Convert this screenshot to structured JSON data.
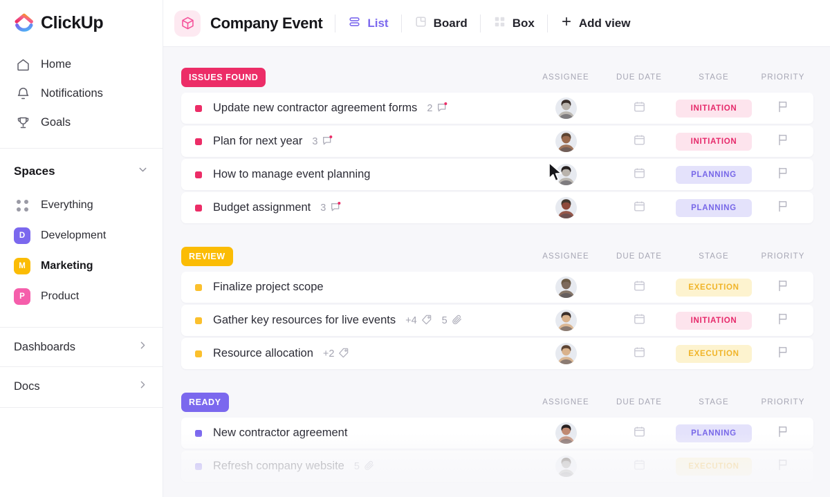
{
  "brand": {
    "name": "ClickUp"
  },
  "sidebar": {
    "nav": [
      {
        "label": "Home",
        "icon": "home-icon"
      },
      {
        "label": "Notifications",
        "icon": "bell-icon"
      },
      {
        "label": "Goals",
        "icon": "trophy-icon"
      }
    ],
    "spaces": {
      "title": "Spaces",
      "collapse_icon": "chevron-down-icon",
      "items": [
        {
          "label": "Everything",
          "icon": "grid-dots-icon",
          "initial": "",
          "color": "",
          "active": false
        },
        {
          "label": "Development",
          "icon": "space-badge",
          "initial": "D",
          "color": "#7b68ee",
          "active": false
        },
        {
          "label": "Marketing",
          "icon": "space-badge",
          "initial": "M",
          "color": "#fbbc05",
          "active": true
        },
        {
          "label": "Product",
          "icon": "space-badge",
          "initial": "P",
          "color": "#f55eab",
          "active": false
        }
      ]
    },
    "sections": [
      {
        "label": "Dashboards",
        "icon": "chevron-right-icon"
      },
      {
        "label": "Docs",
        "icon": "chevron-right-icon"
      }
    ]
  },
  "header": {
    "list_icon": "cube-icon",
    "title": "Company Event",
    "views": [
      {
        "label": "List",
        "icon": "list-icon",
        "active": true
      },
      {
        "label": "Board",
        "icon": "board-icon",
        "active": false
      },
      {
        "label": "Box",
        "icon": "box-icon",
        "active": false
      }
    ],
    "add_view": {
      "label": "Add view",
      "icon": "plus-icon"
    }
  },
  "columns": {
    "assignee": "ASSIGNEE",
    "due_date": "DUE DATE",
    "stage": "STAGE",
    "priority": "PRIORITY"
  },
  "icons": {
    "due_date": "calendar-icon",
    "priority": "flag-icon",
    "comment": "comment-icon",
    "tag": "tag-icon",
    "attachment": "paperclip-icon"
  },
  "colors": {
    "accent_purple": "#7b68ee",
    "issues_found": "#ec2d67",
    "review": "#fbbc05",
    "ready": "#7b68ee",
    "stage_initiation_bg": "#fde4ed",
    "stage_initiation_fg": "#e6296a",
    "stage_planning_bg": "#e4e2fb",
    "stage_planning_fg": "#7767e8",
    "stage_execution_bg": "#fdf3cf",
    "stage_execution_fg": "#f0b429"
  },
  "groups": [
    {
      "name": "ISSUES FOUND",
      "badge_color": "#ec2d67",
      "dot_color": "#ec2d67",
      "tasks": [
        {
          "title": "Update new contractor agreement forms",
          "comments": "2",
          "tags": "",
          "attachments": "",
          "stage": "INITIATION",
          "stage_bg": "#fde4ed",
          "stage_fg": "#e6296a",
          "avatar": "#b9b3ac"
        },
        {
          "title": "Plan for next year",
          "comments": "3",
          "tags": "",
          "attachments": "",
          "stage": "INITIATION",
          "stage_bg": "#fde4ed",
          "stage_fg": "#e6296a",
          "avatar": "#9a6a4e"
        },
        {
          "title": "How to manage event planning",
          "comments": "",
          "tags": "",
          "attachments": "",
          "stage": "PLANNING",
          "stage_bg": "#e4e2fb",
          "stage_fg": "#7767e8",
          "avatar": "#b9b3ac"
        },
        {
          "title": "Budget assignment",
          "comments": "3",
          "tags": "",
          "attachments": "",
          "stage": "PLANNING",
          "stage_bg": "#e4e2fb",
          "stage_fg": "#7767e8",
          "avatar": "#8e4a3c"
        }
      ]
    },
    {
      "name": "REVIEW",
      "badge_color": "#fbbc05",
      "dot_color": "#fbc02d",
      "tasks": [
        {
          "title": "Finalize project scope",
          "comments": "",
          "tags": "",
          "attachments": "",
          "stage": "EXECUTION",
          "stage_bg": "#fdf3cf",
          "stage_fg": "#f0b429",
          "avatar": "#7d6a5c"
        },
        {
          "title": "Gather key resources for live events",
          "comments": "",
          "tags": "+4",
          "attachments": "5",
          "stage": "INITIATION",
          "stage_bg": "#fde4ed",
          "stage_fg": "#e6296a",
          "avatar": "#d9b28c"
        },
        {
          "title": "Resource allocation",
          "comments": "",
          "tags": "+2",
          "attachments": "",
          "stage": "EXECUTION",
          "stage_bg": "#fdf3cf",
          "stage_fg": "#f0b429",
          "avatar": "#d9b28c"
        }
      ]
    },
    {
      "name": "READY",
      "badge_color": "#7b68ee",
      "dot_color": "#7b68ee",
      "tasks": [
        {
          "title": "New contractor agreement",
          "comments": "",
          "tags": "",
          "attachments": "",
          "stage": "PLANNING",
          "stage_bg": "#e4e2fb",
          "stage_fg": "#7767e8",
          "avatar": "#c08a72"
        },
        {
          "title": "Refresh company website",
          "comments": "",
          "tags": "",
          "attachments": "5",
          "stage": "EXECUTION",
          "stage_bg": "#fdf3cf",
          "stage_fg": "#f0b429",
          "avatar": "#8d8a86"
        }
      ]
    }
  ]
}
